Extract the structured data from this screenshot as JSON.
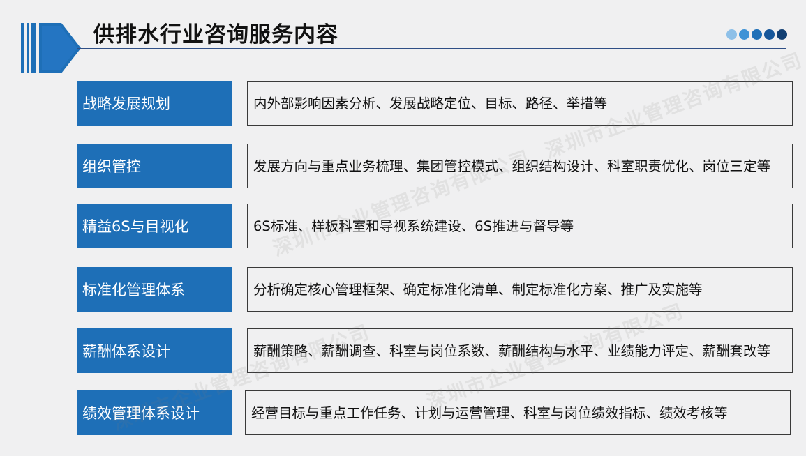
{
  "title": "供排水行业咨询服务内容",
  "colors": {
    "accent": "#1e6fb7",
    "dots": [
      "#8ec0e8",
      "#3f93d6",
      "#1e6fb7",
      "#17579a",
      "#123f73"
    ]
  },
  "rows": [
    {
      "label": "战略发展规划",
      "desc": "内外部影响因素分析、发展战略定位、目标、路径、举措等"
    },
    {
      "label": "组织管控",
      "desc": "发展方向与重点业务梳理、集团管控模式、组织结构设计、科室职责优化、岗位三定等"
    },
    {
      "label": "精益6S与目视化",
      "desc": "6S标准、样板科室和导视系统建设、6S推进与督导等"
    },
    {
      "label": "标准化管理体系",
      "desc": "分析确定核心管理框架、确定标准化清单、制定标准化方案、推广及实施等"
    },
    {
      "label": "薪酬体系设计",
      "desc": "薪酬策略、薪酬调查、科室与岗位系数、薪酬结构与水平、业绩能力评定、薪酬套改等"
    },
    {
      "label": "绩效管理体系设计",
      "desc": "经营目标与重点工作任务、计划与运营管理、科室与岗位绩效指标、绩效考核等"
    }
  ],
  "watermark": "深圳市企业管理咨询有限公司"
}
